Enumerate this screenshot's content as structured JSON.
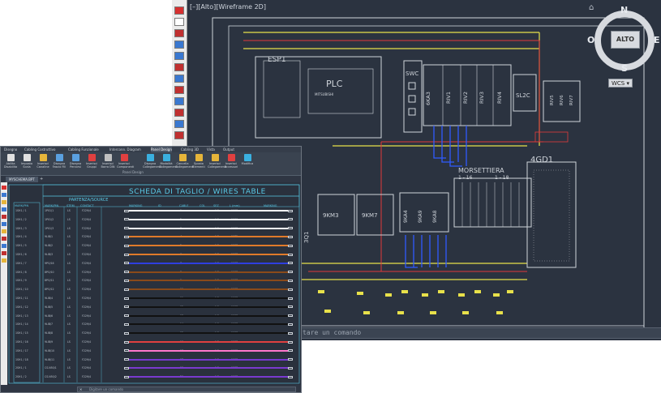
{
  "back_window": {
    "viewport_label": "[–][Alto][Wireframe 2D]",
    "command_placeholder": "tare un comando",
    "compass": {
      "north": "N",
      "south": "S",
      "east": "E",
      "west": "O",
      "center": "ALTO"
    },
    "wcs_label": "WCS",
    "drawing_labels": {
      "esp1": "ESP1",
      "plc": "PLC",
      "mitsubishi": "MITSUBISHI",
      "swc": "SWC",
      "k6ka3": "6KA3",
      "riv1": "RIV1",
      "riv2": "RIV2",
      "riv3": "RIV3",
      "riv4": "RIV4",
      "sl2c": "SL2C",
      "riv5": "RIV5",
      "riv6": "RIV6",
      "riv7": "RIV7",
      "gd1": "4GD1",
      "morsettiera": "MORSETTIERA",
      "m_1_16": "1 - 16",
      "m_1_18": "1 - 18",
      "km3": "9KM3",
      "km7": "9KM7",
      "ka4": "9KA4",
      "ka9": "9KA9",
      "ka8": "9KA8",
      "qf": "3Q1"
    },
    "colors": {
      "bg": "#2b3340",
      "line": "#cfd4da",
      "yellow": "#e8e14a",
      "red": "#e23a3a",
      "blue": "#2f5bff"
    }
  },
  "front_window": {
    "ribbon_tabs": [
      "Disegno",
      "Cabling Costruttivo",
      "Cabling Funzionale",
      "Interconn. Diagram",
      "Panel Design",
      "Cabling 3D",
      "Vista",
      "Output"
    ],
    "active_tab": "Panel Design",
    "ribbon_buttons": [
      {
        "label": "Abilita Disabilita",
        "color": "#e0e0e0"
      },
      {
        "label": "Imposta Scala",
        "color": "#e0e0e0"
      },
      {
        "label": "Inserisci Canaline",
        "color": "#e6b53a"
      },
      {
        "label": "Disegna Fascio Fili",
        "color": "#5aa0e0"
      },
      {
        "label": "Disegna Percorsi",
        "color": "#5aa0e0"
      },
      {
        "label": "Inserisci Gruppi",
        "color": "#e04040"
      },
      {
        "label": "Inserisci Barra DIN",
        "color": "#c0c0c0"
      },
      {
        "label": "Inserisci Componenti",
        "color": "#e04040"
      },
      {
        "label": "Disegna Collegamenti",
        "color": "#3ab0e0"
      },
      {
        "label": "Modalità Collegamenti",
        "color": "#3ab0e0"
      },
      {
        "label": "Cancella Collegamenti",
        "color": "#e6b53a"
      },
      {
        "label": "Sposta Elementi",
        "color": "#e6b53a"
      },
      {
        "label": "Inserisci Collegamenti",
        "color": "#e6b53a"
      },
      {
        "label": "Inserisci Accessori",
        "color": "#e04040"
      },
      {
        "label": "Modifica",
        "color": "#3ab0e0"
      }
    ],
    "ribbon_group_label": "Panel Design",
    "doc_tab": "MYSCHEMA.BPT",
    "doc_tab_plus": "+",
    "table_title": "SCHEDA DI TAGLIO / WIRES TABLE",
    "group_title": "PARTENZA/SOURCE",
    "headers": [
      "MARK/PIN",
      "STEM",
      "CONTACT",
      "MARKING",
      "ID",
      "CABLE",
      "COL",
      "SEZ",
      "L (mm)",
      "MARKING"
    ],
    "left_column_header": "MARK/PIN",
    "rows": [
      {
        "left": "1SH1 / 1",
        "source": "1P01/1",
        "stem": "LS",
        "contact": "F229/4",
        "cable": "1",
        "sez": "1.5",
        "len": "1963",
        "wire": "#ffffff"
      },
      {
        "left": "1SH1 / 2",
        "source": "1P01/2",
        "stem": "LS",
        "contact": "F229/4",
        "cable": "2",
        "sez": "1.5",
        "len": "1960",
        "wire": "#ffffff"
      },
      {
        "left": "1SH1 / 3",
        "source": "1P01/3",
        "stem": "LS",
        "contact": "F229/4",
        "cable": "3",
        "sez": "1.5",
        "len": "1963",
        "wire": "#ffffff"
      },
      {
        "left": "1SH1 / 4",
        "source": "9LIB/1",
        "stem": "LS",
        "contact": "F229/4",
        "cable": "4",
        "sez": "1.5",
        "len": "1975",
        "wire": "#e07a2a"
      },
      {
        "left": "1SH1 / 5",
        "source": "9LIB/2",
        "stem": "LS",
        "contact": "F229/4",
        "cable": "5",
        "sez": "1.5",
        "len": "1963",
        "wire": "#e07a2a"
      },
      {
        "left": "1SH1 / 6",
        "source": "9LIB/3",
        "stem": "LS",
        "contact": "F229/4",
        "cable": "6",
        "sez": "1.5",
        "len": "1963",
        "wire": "#e07a2a"
      },
      {
        "left": "1SH1 / 7",
        "source": "9PO/16",
        "stem": "LS",
        "contact": "F229/4",
        "cable": "7",
        "sez": "1.5",
        "len": "1963",
        "wire": "#2f3fe0"
      },
      {
        "left": "1SH1 / 8",
        "source": "8PO/10",
        "stem": "LS",
        "contact": "F229/4",
        "cable": "8",
        "sez": "1.5",
        "len": "1963",
        "wire": "#8a4a1a"
      },
      {
        "left": "1SH1 / 9",
        "source": "8PO/11",
        "stem": "LS",
        "contact": "F229/4",
        "cable": "9",
        "sez": "1.5",
        "len": "1963",
        "wire": "#8a4a1a"
      },
      {
        "left": "1SH1 / 10",
        "source": "8PO/12",
        "stem": "LS",
        "contact": "F229/4",
        "cable": "10",
        "sez": "1.5",
        "len": "1963",
        "wire": "#8a4a1a"
      },
      {
        "left": "1SH1 / 11",
        "source": "9LIB/4",
        "stem": "LS",
        "contact": "F229/4",
        "cable": "11",
        "sez": "1.5",
        "len": "1963",
        "wire": "#111111"
      },
      {
        "left": "1SH1 / 12",
        "source": "9LIB/5",
        "stem": "LS",
        "contact": "F229/4",
        "cable": "12",
        "sez": "1.5",
        "len": "1963",
        "wire": "#111111"
      },
      {
        "left": "1SH1 / 13",
        "source": "9LIB/6",
        "stem": "LS",
        "contact": "F229/4",
        "cable": "13",
        "sez": "1.5",
        "len": "1963",
        "wire": "#111111"
      },
      {
        "left": "1SH1 / 14",
        "source": "9LIB/7",
        "stem": "LS",
        "contact": "F229/4",
        "cable": "14",
        "sez": "1.5",
        "len": "1963",
        "wire": "#111111"
      },
      {
        "left": "1SH1 / 15",
        "source": "9LIB/8",
        "stem": "LS",
        "contact": "F229/4",
        "cable": "15",
        "sez": "1.5",
        "len": "1963",
        "wire": "#111111"
      },
      {
        "left": "1SH1 / 16",
        "source": "9LIB/9",
        "stem": "LS",
        "contact": "F229/4",
        "cable": "16",
        "sez": "1.5",
        "len": "1963",
        "wire": "#e04040"
      },
      {
        "left": "1SH1 / 17",
        "source": "9LIB/10",
        "stem": "LS",
        "contact": "F229/4",
        "cable": "17",
        "sez": "1.5",
        "len": "1963",
        "wire": "#ff77cc"
      },
      {
        "left": "1SH1 / 18",
        "source": "9LIB/11",
        "stem": "LS",
        "contact": "F229/4",
        "cable": "18",
        "sez": "1.5",
        "len": "1963",
        "wire": "#7a3ad0"
      },
      {
        "left": "2SH1 / 1",
        "source": "CS.N50/1",
        "stem": "LS",
        "contact": "F229/4",
        "cable": "19",
        "sez": "1.5",
        "len": "1963",
        "wire": "#7a3ad0"
      },
      {
        "left": "2SH1 / 2",
        "source": "CS.N50/2",
        "stem": "LS",
        "contact": "F229/4",
        "cable": "20",
        "sez": "1.5",
        "len": "1963",
        "wire": "#7a3ad0"
      }
    ],
    "status_placeholder": "Digitare un comando",
    "colors": {
      "bg": "#2a313d",
      "accent": "#59c9e6"
    }
  }
}
